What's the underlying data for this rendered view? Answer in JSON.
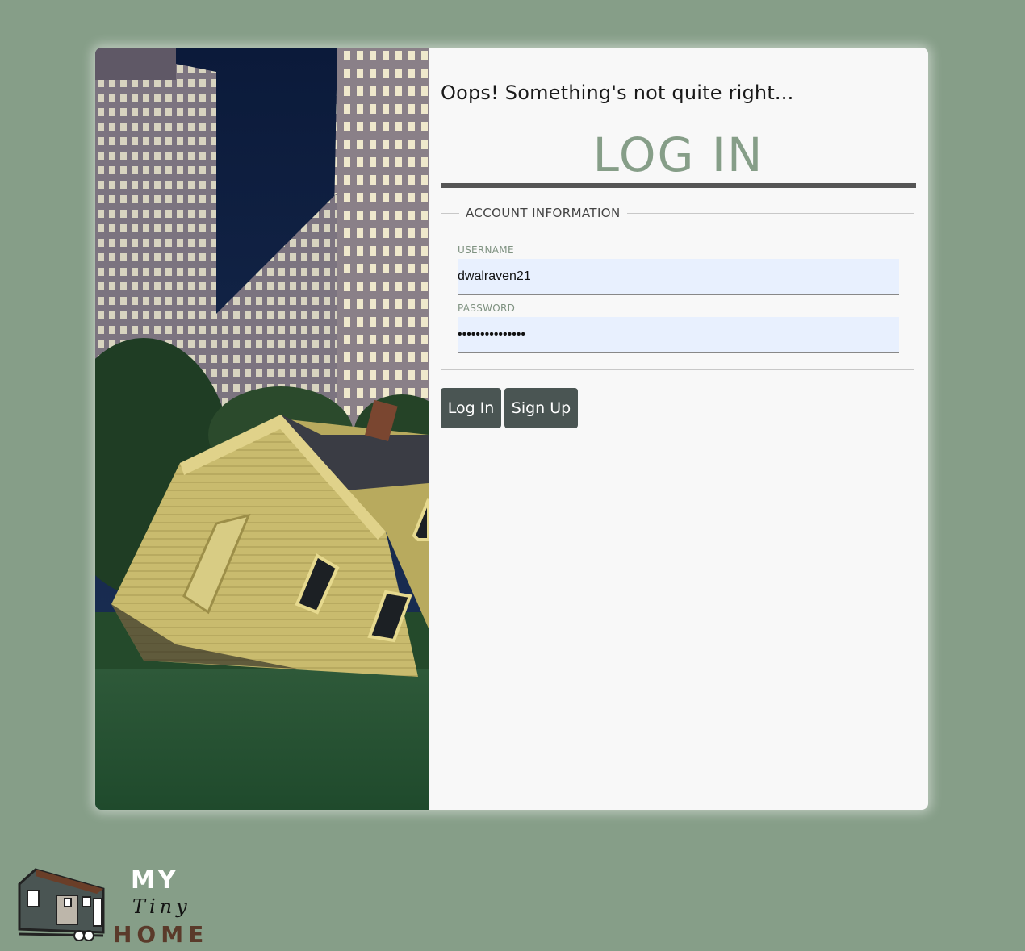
{
  "form": {
    "error_message": "Oops! Something's not quite right...",
    "title": "LOG IN",
    "fieldset_legend": "ACCOUNT INFORMATION",
    "username_label": "USERNAME",
    "username_value": "dwalraven21",
    "password_label": "PASSWORD",
    "password_value": "•••••••••••••••",
    "login_button": "Log In",
    "signup_button": "Sign Up"
  },
  "brand": {
    "line1": "MY",
    "line2": "Tiny",
    "line3": "HOME"
  },
  "colors": {
    "background": "#869e88",
    "title": "#869e88",
    "button": "#4a5553",
    "input_fill": "#e8f0fe"
  }
}
